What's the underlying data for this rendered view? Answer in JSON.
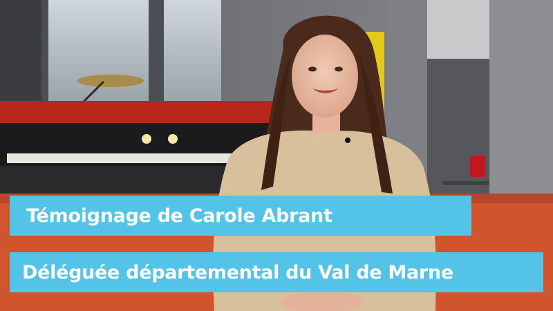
{
  "caption": {
    "name_line": "Témoignage de Carole Abrant",
    "role_line": "Déléguée départemental du Val de Marne"
  },
  "colors": {
    "banner_background": "#54c3e8",
    "banner_text": "#ffffff",
    "sofa": "#d2542d",
    "sweater": "#d8c09c",
    "piano_red": "#b7271c"
  },
  "scene": {
    "subject": "young woman with long brown hair in a beige knit sweater, seated on an orange sofa, smiling",
    "background": "red and black piano, cymbal, window, grey shelving unit with yellow frame and red mug"
  }
}
